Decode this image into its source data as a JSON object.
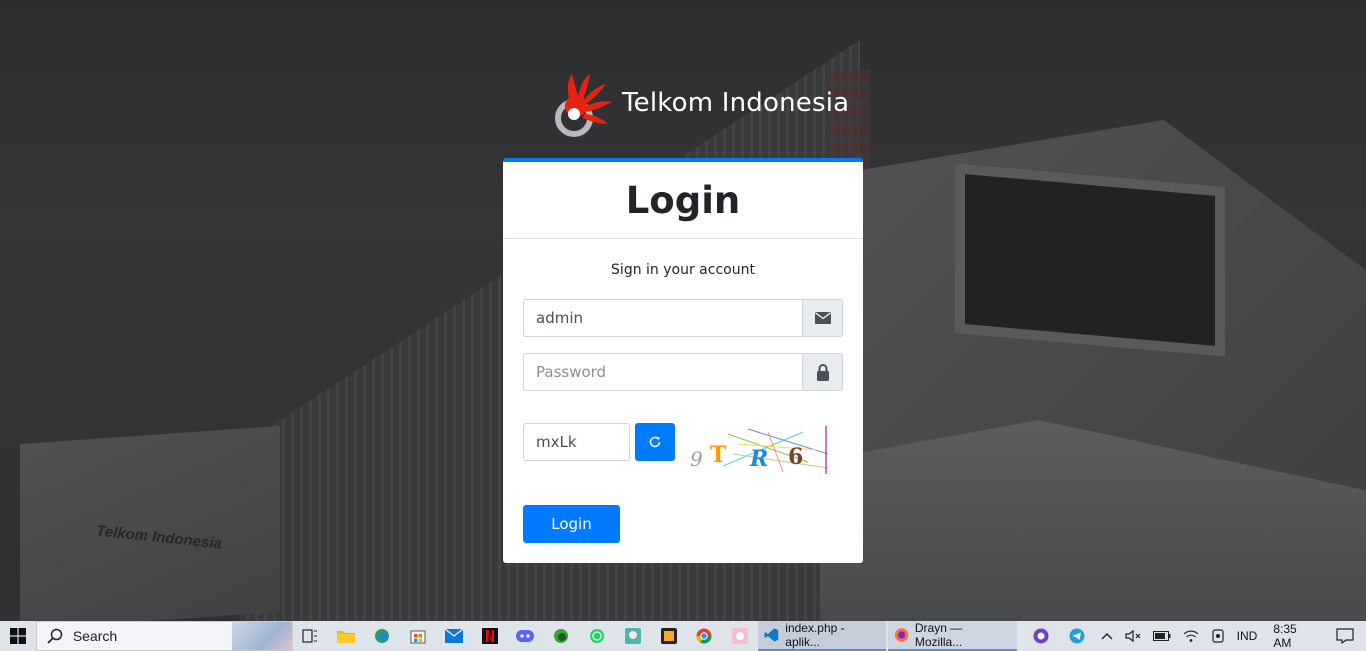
{
  "brand": {
    "name": "Telkom Indonesia"
  },
  "login_card": {
    "title": "Login",
    "subtitle": "Sign in your account",
    "username": {
      "value": "admin",
      "placeholder": "",
      "icon": "envelope-icon"
    },
    "password": {
      "value": "",
      "placeholder": "Password",
      "icon": "lock-icon"
    },
    "captcha": {
      "value": "mxLk",
      "refresh_icon": "refresh-icon",
      "image_text": "9TR6"
    },
    "submit_label": "Login"
  },
  "background": {
    "building_logo_text": "Telkom Indonesia"
  },
  "colors": {
    "primary": "#007bff",
    "brand_red": "#e42313"
  },
  "taskbar": {
    "search_label": "Search",
    "apps": [
      {
        "name": "task-view-icon"
      },
      {
        "name": "file-explorer-icon"
      },
      {
        "name": "edge-icon"
      },
      {
        "name": "store-icon"
      },
      {
        "name": "mail-icon"
      },
      {
        "name": "netflix-icon"
      },
      {
        "name": "discord-icon"
      },
      {
        "name": "edge-dev-icon"
      },
      {
        "name": "whatsapp-icon"
      },
      {
        "name": "anime-app-icon"
      },
      {
        "name": "xampp-icon"
      },
      {
        "name": "chrome-icon"
      },
      {
        "name": "game-app-icon"
      }
    ],
    "vscode_label": "index.php - aplik...",
    "firefox_label": "Drayn — Mozilla...",
    "tray": {
      "language": "IND",
      "time": "8:35 AM"
    }
  }
}
